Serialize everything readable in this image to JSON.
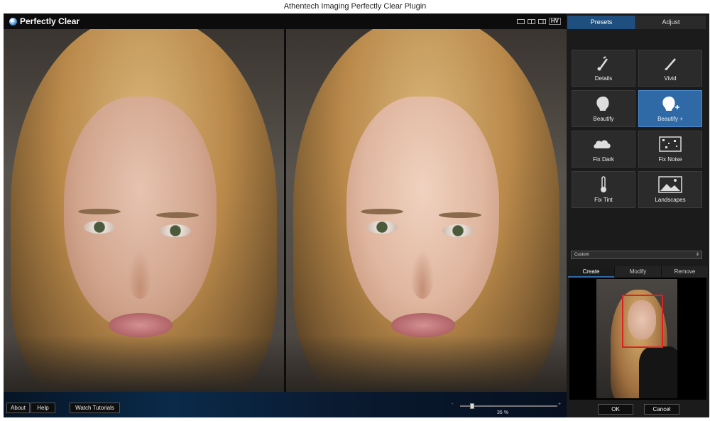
{
  "window": {
    "title": "Athentech Imaging Perfectly Clear Plugin"
  },
  "header": {
    "logo_text": "Perfectly Clear",
    "view_modes": [
      "single-view-icon",
      "split-view-icon",
      "side-by-side-icon",
      "HV"
    ]
  },
  "view_mode_hv_label": "HV",
  "panel": {
    "tabs": [
      {
        "label": "Presets",
        "active": true
      },
      {
        "label": "Adjust",
        "active": false
      }
    ],
    "presets": [
      {
        "label": "Details",
        "icon": "brush-icon",
        "active": false
      },
      {
        "label": "Vivid",
        "icon": "paintbrush-icon",
        "active": false
      },
      {
        "label": "Beautify",
        "icon": "face-silhouette-icon",
        "active": false
      },
      {
        "label": "Beautify +",
        "icon": "face-silhouette-plus-icon",
        "active": true
      },
      {
        "label": "Fix Dark",
        "icon": "cloud-icon",
        "active": false
      },
      {
        "label": "Fix Noise",
        "icon": "noise-icon",
        "active": false
      },
      {
        "label": "Fix Tint",
        "icon": "thermometer-icon",
        "active": false
      },
      {
        "label": "Landscapes",
        "icon": "landscape-icon",
        "active": false
      }
    ],
    "custom_select": {
      "value": "Custom"
    },
    "face_tabs": [
      {
        "label": "Create",
        "active": true
      },
      {
        "label": "Modify",
        "active": false
      },
      {
        "label": "Remove",
        "active": false
      }
    ]
  },
  "footer": {
    "about_label": "About",
    "help_label": "Help",
    "tutorials_label": "Watch Tutorials",
    "zoom": {
      "value_label": "35 %",
      "fraction": 0.13,
      "min_label": "-",
      "max_label": "+"
    },
    "ok_label": "OK",
    "cancel_label": "Cancel"
  },
  "colors": {
    "accent": "#2f6aa6",
    "tab_active": "#1e4f7f",
    "face_box": "#e02020"
  }
}
